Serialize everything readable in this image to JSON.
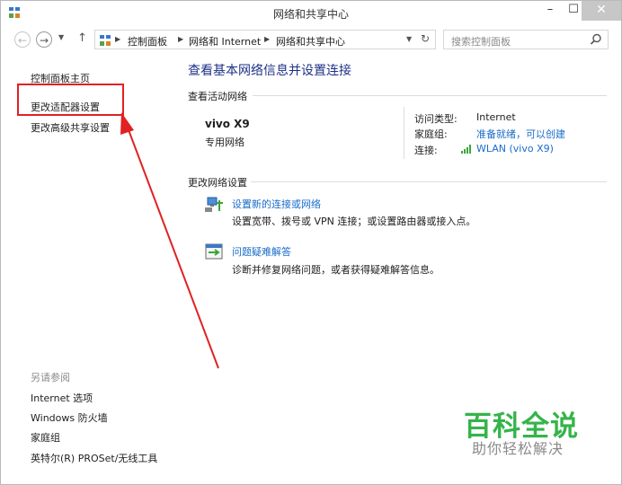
{
  "window": {
    "title": "网络和共享中心",
    "buttons": {
      "minimize": "–",
      "maximize": "☐",
      "close": "✕"
    }
  },
  "navbar": {
    "breadcrumb": [
      "控制面板",
      "网络和 Internet",
      "网络和共享中心"
    ],
    "search_placeholder": "搜索控制面板"
  },
  "sidebar": {
    "home": "控制面板主页",
    "links": [
      "更改适配器设置",
      "更改高级共享设置"
    ],
    "see_also_heading": "另请参阅",
    "see_also": [
      "Internet 选项",
      "Windows 防火墙",
      "家庭组",
      "英特尔(R) PROSet/无线工具"
    ]
  },
  "main": {
    "title": "查看基本网络信息并设置连接",
    "active_heading": "查看活动网络",
    "network": {
      "name": "vivo X9",
      "type": "专用网络",
      "access_type_label": "访问类型:",
      "access_type_value": "Internet",
      "homegroup_label": "家庭组:",
      "homegroup_value": "准备就绪，可以创建",
      "connection_label": "连接:",
      "connection_value": "WLAN (vivo X9)"
    },
    "change_heading": "更改网络设置",
    "tasks": [
      {
        "title": "设置新的连接或网络",
        "desc": "设置宽带、拨号或 VPN 连接；或设置路由器或接入点。"
      },
      {
        "title": "问题疑难解答",
        "desc": "诊断并修复网络问题，或者获得疑难解答信息。"
      }
    ]
  },
  "watermark": {
    "line1": "百科全说",
    "line2": "助你轻松解决"
  },
  "colors": {
    "link": "#1a6cc8",
    "title": "#1e3287",
    "highlight": "#e02222",
    "watermark": "#35b44a"
  }
}
